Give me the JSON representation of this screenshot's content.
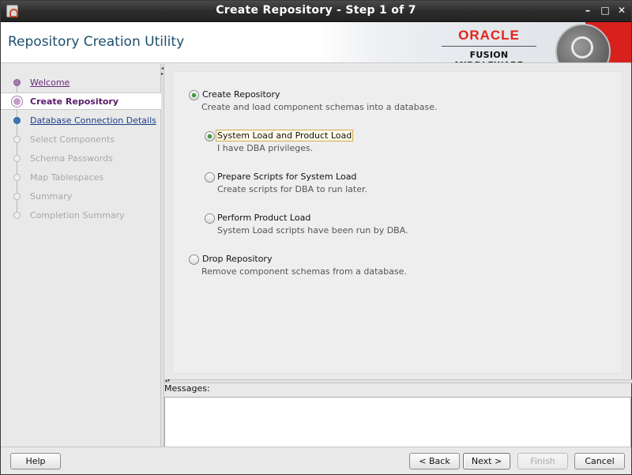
{
  "window": {
    "title": "Create Repository - Step 1 of 7",
    "controls": {
      "minimize": "–",
      "maximize": "□",
      "close": "✕"
    }
  },
  "banner": {
    "heading": "Repository Creation Utility",
    "brand": "ORACLE",
    "brand_sub": "FUSION MIDDLEWARE",
    "brand_color": "#e2231a"
  },
  "nav": {
    "items": [
      {
        "label": "Welcome",
        "state": "done"
      },
      {
        "label": "Create Repository",
        "state": "current"
      },
      {
        "label": "Database Connection Details",
        "state": "next"
      },
      {
        "label": "Select Components",
        "state": "disabled"
      },
      {
        "label": "Schema Passwords",
        "state": "disabled"
      },
      {
        "label": "Map Tablespaces",
        "state": "disabled"
      },
      {
        "label": "Summary",
        "state": "disabled"
      },
      {
        "label": "Completion Summary",
        "state": "disabled"
      }
    ]
  },
  "options": {
    "create": {
      "label": "Create Repository",
      "description": "Create and load component schemas into a database.",
      "selected": true,
      "sub": [
        {
          "label": "System Load and Product Load",
          "description": "I have DBA privileges.",
          "selected": true
        },
        {
          "label": "Prepare Scripts for System Load",
          "description": "Create scripts for DBA to run later.",
          "selected": false
        },
        {
          "label": "Perform Product Load",
          "description": "System Load scripts have been run by DBA.",
          "selected": false
        }
      ]
    },
    "drop": {
      "label": "Drop Repository",
      "description": "Remove component schemas from a database.",
      "selected": false
    }
  },
  "messages": {
    "label": "Messages:",
    "text": ""
  },
  "buttons": {
    "help": "Help",
    "back": "< Back",
    "next": "Next >",
    "finish": "Finish",
    "cancel": "Cancel"
  }
}
